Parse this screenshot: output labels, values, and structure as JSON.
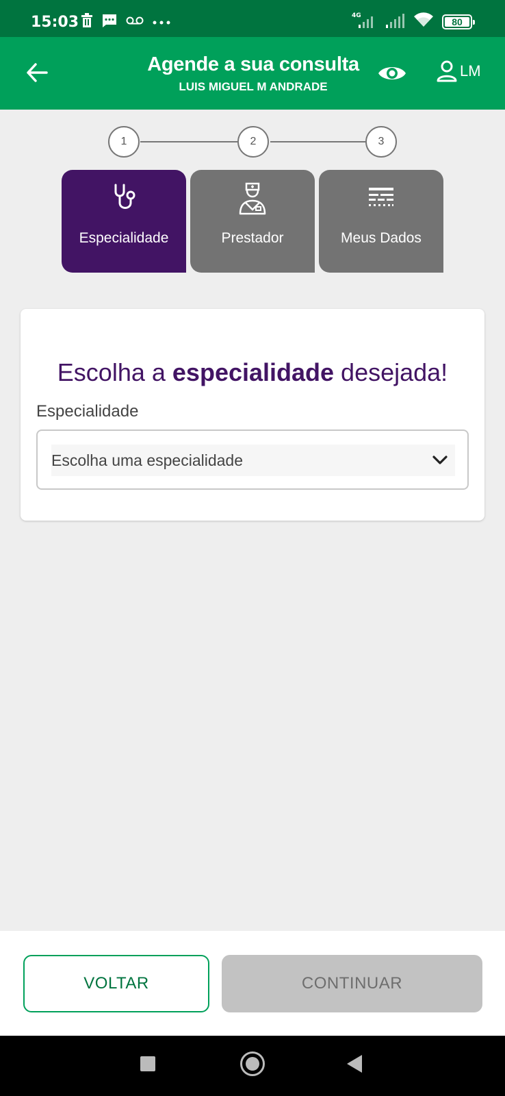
{
  "status_bar": {
    "time": "15:03",
    "network": "4G",
    "battery": "80",
    "icons_left": [
      "trash-icon",
      "message-icon",
      "voicemail-icon",
      "more-dots-icon"
    ],
    "icons_right": [
      "signal-4g-icon",
      "signal-icon",
      "wifi-icon",
      "battery-icon"
    ]
  },
  "app_bar": {
    "title": "Agende a sua consulta",
    "subtitle": "LUIS MIGUEL M ANDRADE",
    "user_initials": "LM",
    "background": "#00a05a"
  },
  "stepper": {
    "steps": [
      "1",
      "2",
      "3"
    ]
  },
  "tabs": [
    {
      "label": "Especialidade",
      "icon": "stethoscope-icon",
      "active": true
    },
    {
      "label": "Prestador",
      "icon": "doctor-icon",
      "active": false
    },
    {
      "label": "Meus Dados",
      "icon": "data-list-icon",
      "active": false
    }
  ],
  "form": {
    "heading_pre": "Escolha a ",
    "heading_bold": "especialidade",
    "heading_post": " desejada!",
    "field_label": "Especialidade",
    "select_value": "Escolha uma especialidade"
  },
  "actions": {
    "back_label": "VOLTAR",
    "continue_label": "CONTINUAR"
  },
  "colors": {
    "primary_green": "#00a05a",
    "dark_green": "#00743f",
    "purple": "#421464",
    "inactive_gray": "#737373"
  }
}
